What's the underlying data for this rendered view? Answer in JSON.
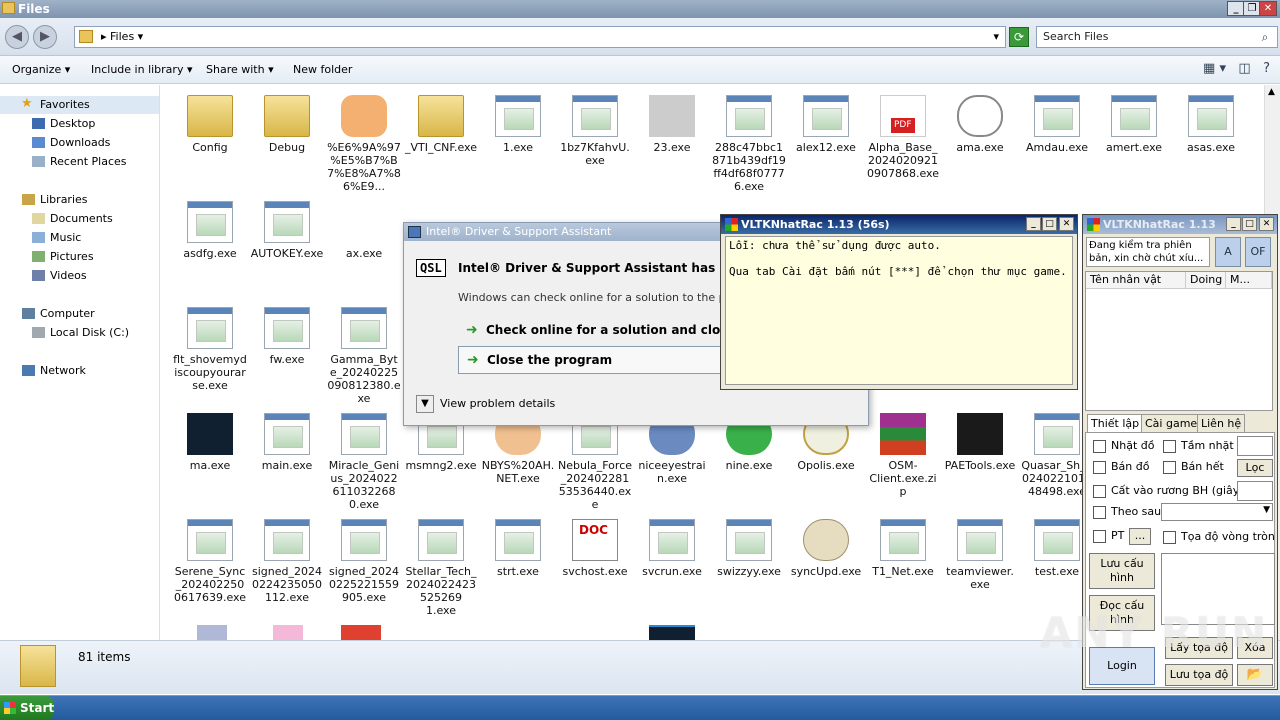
{
  "window": {
    "title": "Files"
  },
  "address": {
    "path": "Files",
    "search_placeholder": "Search Files"
  },
  "commands": [
    "Organize",
    "Include in library",
    "Share with",
    "New folder"
  ],
  "nav": {
    "favorites": "Favorites",
    "fav_items": [
      "Desktop",
      "Downloads",
      "Recent Places"
    ],
    "libraries": "Libraries",
    "lib_items": [
      "Documents",
      "Music",
      "Pictures",
      "Videos"
    ],
    "computer": "Computer",
    "comp_items": [
      "Local Disk (C:)"
    ],
    "network": "Network"
  },
  "files": {
    "row1": [
      "Config",
      "Debug",
      "%E6%9A%97%E5%B7%B7%E8%A7%86%E9...",
      "_VTI_CNF.exe",
      "1.exe",
      "1bz7KfahvU.exe",
      "23.exe",
      "288c47bbc1871b439df19ff4df68f07776.exe",
      "alex12.exe",
      "Alpha_Base_20240209210907868.exe",
      "ama.exe",
      "Amdau.exe",
      "amert.exe",
      "asas.exe"
    ],
    "row2": [
      "asdfg.exe",
      "AUTOKEY.exe",
      "ax.exe"
    ],
    "row3": [
      "flt_shovemydiscoupyourarse.exe",
      "fw.exe",
      "Gamma_Byte_20240225090812380.exe"
    ],
    "row4": [
      "ma.exe",
      "main.exe",
      "Miracle_Genius_2024022611032268 0.exe",
      "msmng2.exe",
      "NBYS%20AH.NET.exe",
      "Nebula_Force_20240228153536440.exe",
      "niceeyestrain.exe",
      "nine.exe",
      "Opolis.exe",
      "OSM-Client.exe.zip",
      "PAETools.exe",
      "Quasar_Sh_2024022101148498.exe"
    ],
    "row5": [
      "Serene_Sync_2024022500617639.exe",
      "signed_20240224235050112.exe",
      "signed_20240225221559905.exe",
      "Stellar_Tech_2024022423525269 1.exe",
      "strt.exe",
      "svchost.exe",
      "svcrun.exe",
      "swizzyy.exe",
      "syncUpd.exe",
      "T1_Net.exe",
      "teamviewer.exe",
      "test.exe"
    ]
  },
  "status": {
    "count": "81 items"
  },
  "taskbar": {
    "start": "Start"
  },
  "intel": {
    "title": "Intel® Driver & Support Assistant",
    "heading": "Intel® Driver & Support Assistant has stopped",
    "qsl": "QSL",
    "sub": "Windows can check online for a solution to the problem",
    "opt1": "Check online for a solution and close the p",
    "opt2": "Close the program",
    "details": "View problem details"
  },
  "vmsg": {
    "title": "VLTKNhatRac 1.13 (56s)",
    "line1": "Lỗi: chưa thể sử dụng được auto.",
    "line2": "Qua tab Cài đặt bấm nút [***] để chọn thư mục game."
  },
  "vmain": {
    "title": "VLTKNhatRac 1.13",
    "status": "Đang kiểm tra phiên bản, xin chờ chút xíu...",
    "btn_a": "A",
    "btn_of": "OF",
    "col_name": "Tên nhân vật",
    "col_doing": "Doing",
    "col_m": "M...",
    "tab1": "Thiết lập",
    "tab2": "Cài game",
    "tab3": "Liên hệ",
    "ck_nhat": "Nhặt đồ",
    "ck_tamnhat": "Tầm nhặt",
    "ck_ban": "Bán đồ",
    "ck_banhet": "Bán hết",
    "btn_loc": "Lọc",
    "ck_cat": "Cất vào rương BH (giây)",
    "ck_theo": "Theo sau",
    "ck_pt": "PT",
    "btn_dots": "...",
    "ck_toado": "Tọa độ vòng tròn",
    "btn_luucauhinh": "Lưu cấu hình",
    "btn_doccauhinh": "Đọc cấu hình",
    "btn_laytoado": "Lấy tọa độ",
    "btn_xoa": "Xóa",
    "btn_login": "Login",
    "btn_luutoado": "Lưu tọa độ"
  },
  "watermark": "ANY RUN"
}
